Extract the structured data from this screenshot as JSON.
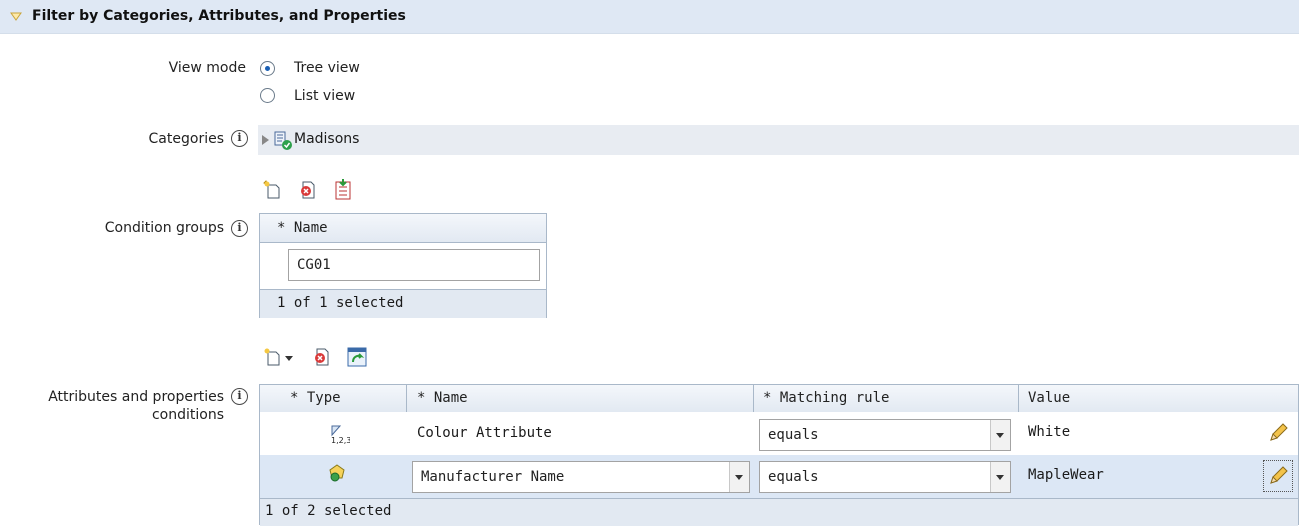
{
  "section": {
    "title": "Filter by Categories, Attributes, and Properties",
    "toggle_icon": "collapse-triangle-icon"
  },
  "view_mode": {
    "label": "View mode",
    "options": [
      {
        "label": "Tree view",
        "checked": true
      },
      {
        "label": "List view",
        "checked": false
      }
    ]
  },
  "categories": {
    "label": "Categories",
    "tree_item": "Madisons"
  },
  "condition_groups": {
    "label": "Condition groups",
    "toolbar_icons": [
      "new-icon",
      "delete-icon",
      "load-icon"
    ],
    "column_header": "* Name",
    "rows": [
      {
        "name": "CG01"
      }
    ],
    "footer": "1 of 1 selected"
  },
  "attributes": {
    "label_line1": "Attributes and properties",
    "label_line2": "conditions",
    "toolbar_icons": [
      "new-dropdown-icon",
      "delete-icon",
      "refresh-icon"
    ],
    "columns": [
      "* Type",
      "* Name",
      "* Matching rule",
      "Value"
    ],
    "rows": [
      {
        "type_icon": "numeric-attribute-icon",
        "name": "Colour Attribute",
        "matching_rule": "equals",
        "value": "White",
        "selected": false
      },
      {
        "type_icon": "property-icon",
        "name": "Manufacturer Name",
        "matching_rule": "equals",
        "value": "MapleWear",
        "selected": true
      }
    ],
    "footer": "1 of 2 selected"
  }
}
